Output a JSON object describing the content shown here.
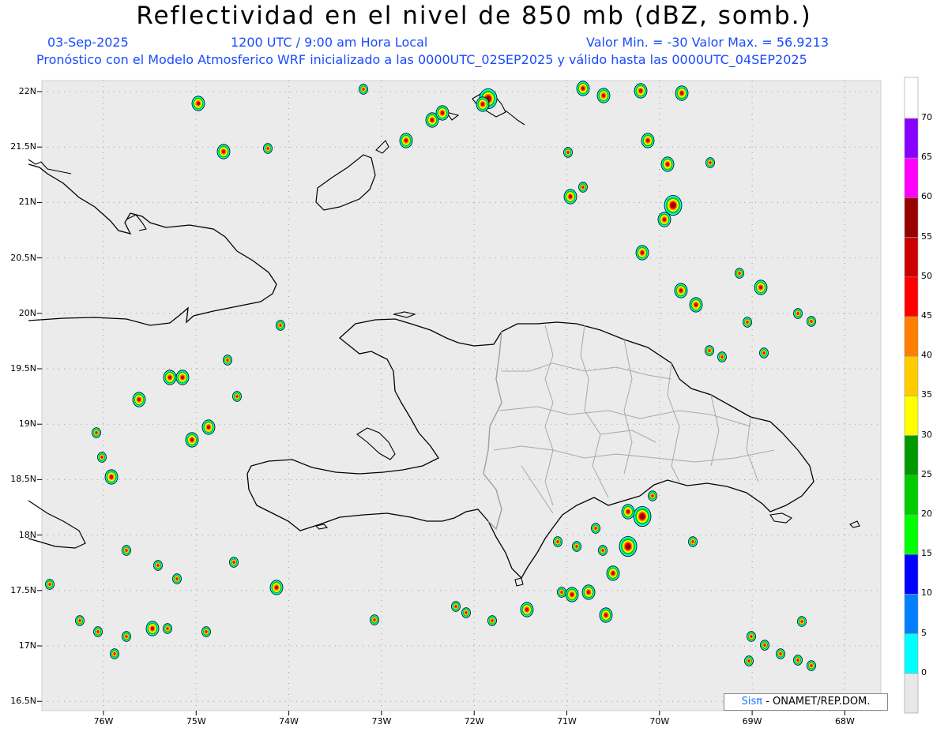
{
  "header": {
    "title": "Reflectividad en el nivel de 850 mb (dBZ, somb.)",
    "date": "03-Sep-2025",
    "time": "1200 UTC / 9:00 am Hora Local",
    "minmax": "Valor Min. = -30  Valor Max. = 56.9213",
    "forecast": "Pronóstico con el Modelo Atmosferico WRF inicializado a las 0000UTC_02SEP2025 y válido hasta las  0000UTC_04SEP2025"
  },
  "credit": {
    "brand": "Sisπ",
    "text": " - ONAMET/REP.DOM."
  },
  "axes": {
    "lat_labels": [
      "22N",
      "21.5N",
      "21N",
      "20.5N",
      "20N",
      "19.5N",
      "19N",
      "18.5N",
      "18N",
      "17.5N",
      "17N",
      "16.5N"
    ],
    "lat_values": [
      22,
      21.5,
      21,
      20.5,
      20,
      19.5,
      19,
      18.5,
      18,
      17.5,
      17,
      16.5
    ],
    "lon_labels": [
      "76W",
      "75W",
      "74W",
      "73W",
      "72W",
      "71W",
      "70W",
      "69W",
      "68W"
    ],
    "lon_values": [
      -76,
      -75,
      -74,
      -73,
      -72,
      -71,
      -70,
      -69,
      -68
    ]
  },
  "colorbar": {
    "labels": [
      "70",
      "65",
      "60",
      "55",
      "50",
      "45",
      "40",
      "35",
      "30",
      "25",
      "20",
      "15",
      "10",
      "5",
      "0"
    ],
    "colors": [
      "#ffffff",
      "#8800ff",
      "#ff00ff",
      "#990000",
      "#cc0000",
      "#ff0000",
      "#ff8000",
      "#ffcc00",
      "#ffff00",
      "#009900",
      "#00cc00",
      "#00ff00",
      "#0000ff",
      "#0080ff",
      "#00ffff",
      "#e8e8e8"
    ]
  },
  "colors": {
    "map_background": "#ebebeb",
    "coastline": "#000000",
    "province_lines": "#a0a0a0"
  }
}
